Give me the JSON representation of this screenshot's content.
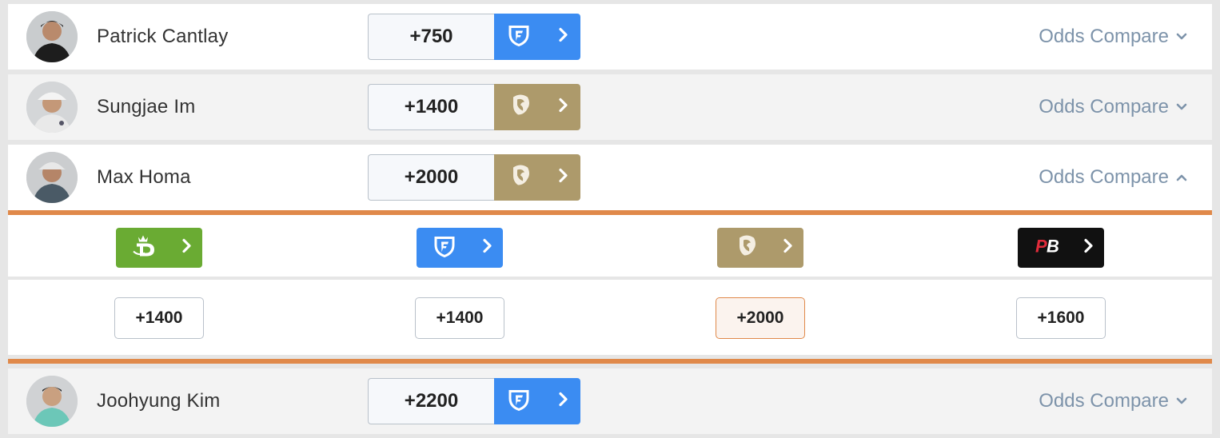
{
  "rows": [
    {
      "name": "Patrick Cantlay",
      "odds": "+750",
      "book": "fanduel-logo-icon",
      "compare_label": "Odds Compare",
      "expanded": false
    },
    {
      "name": "Sungjae Im",
      "odds": "+1400",
      "book": "betmgm-logo-icon",
      "compare_label": "Odds Compare",
      "expanded": false
    },
    {
      "name": "Max Homa",
      "odds": "+2000",
      "book": "betmgm-logo-icon",
      "compare_label": "Odds Compare",
      "expanded": true
    },
    {
      "name": "Joohyung Kim",
      "odds": "+2200",
      "book": "fanduel-logo-icon",
      "compare_label": "Odds Compare",
      "expanded": false
    }
  ],
  "compare_panel": {
    "books": [
      {
        "book": "draftkings-logo-icon",
        "odds": "+1400",
        "best": false
      },
      {
        "book": "fanduel-logo-icon",
        "odds": "+1400",
        "best": false
      },
      {
        "book": "betmgm-logo-icon",
        "odds": "+2000",
        "best": true
      },
      {
        "book": "pointsbet-logo-icon",
        "odds": "+1600",
        "best": false
      }
    ]
  },
  "colors": {
    "fanduel": "#3b8cf2",
    "betmgm": "#ad9a6b",
    "draftkings": "#6aab33",
    "pointsbet": "#111111",
    "accent": "#e0894a",
    "compare_text": "#7d93aa"
  }
}
